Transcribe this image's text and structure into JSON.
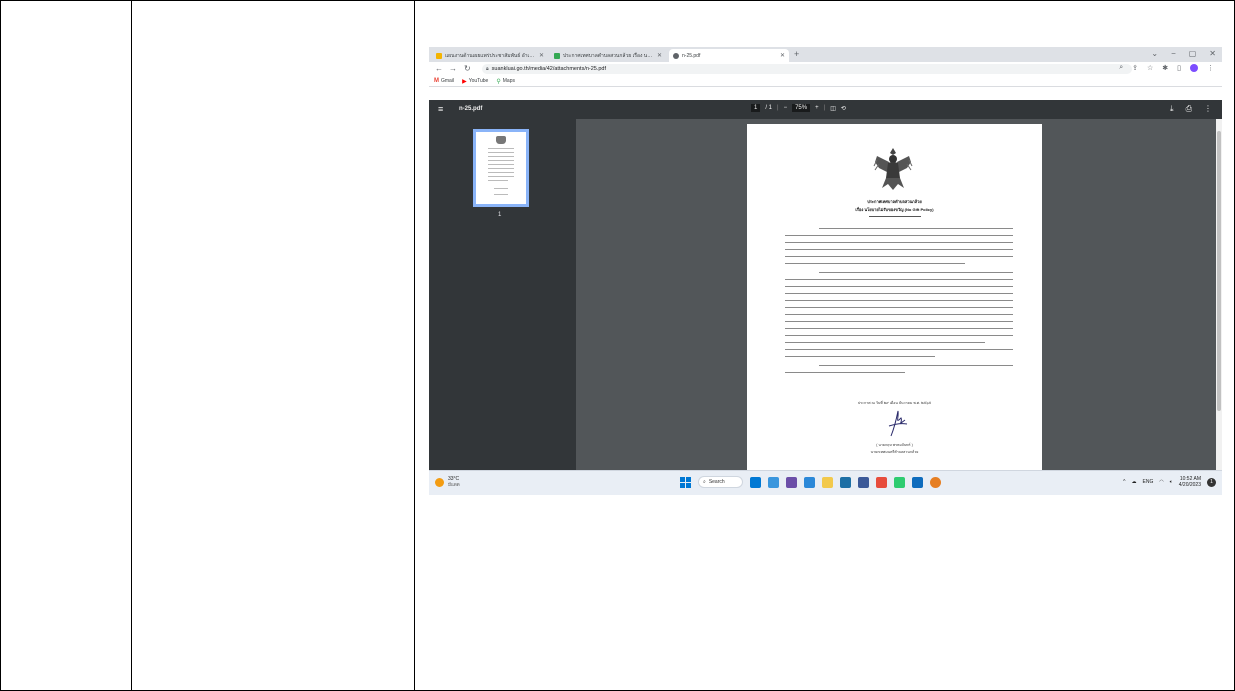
{
  "browser": {
    "tabs": [
      {
        "label": "แผนงานด้านเผยแพร่ประชาสัมพันธ์ อำเภอสวนหลวง",
        "color": "#f4b400"
      },
      {
        "label": "ประกาศเทศบาลตำบลสวนกล้วย เรื่อง นโยบาย",
        "color": "#34a853"
      },
      {
        "label": "n-25.pdf",
        "color": "#5f6368"
      }
    ],
    "new_tab": "+",
    "window_controls": [
      "⌄",
      "−",
      "▢",
      "✕"
    ],
    "url": "suankluai.go.th/media/42/attachments/n-25.pdf",
    "bookmarks": [
      {
        "icon": "M",
        "label": "Gmail",
        "color": "#ea4335"
      },
      {
        "icon": "▶",
        "label": "YouTube",
        "color": "#ff0000"
      },
      {
        "icon": "⚲",
        "label": "Maps",
        "color": "#34a853"
      }
    ]
  },
  "pdf": {
    "file_name": "n-25.pdf",
    "page_current": "1",
    "page_total": "/ 1",
    "zoom": "75%",
    "zoom_out": "−",
    "zoom_in": "+",
    "thumbnail_label": "1",
    "document": {
      "title_line1": "ประกาศเทศบาลตำบลสวนกล้วย",
      "title_line2": "เรื่อง นโยบายไม่รับของขวัญ (No Gift Policy)",
      "date_line": "ประกาศ ณ วันที่ ๒๙ เดือน ธันวาคม พ.ศ. ๒๕๖๕",
      "signer_name": "( นายกฤษ พรหมจันทร์ )",
      "signer_position": "นายกเทศมนตรีตำบลสวนกล้วย"
    }
  },
  "taskbar": {
    "temperature": "33°C",
    "condition": "มีแดด",
    "search_label": "Search",
    "apps": [
      "#0078d4",
      "#3a96dd",
      "#6b4ea8",
      "#2b88d8",
      "#f2c94c",
      "#1d6fa5",
      "#3b5998",
      "#e74c3c",
      "#2ecc71",
      "#0f6cbd",
      "#e67e22"
    ],
    "language": "ENG",
    "time": "10:52 AM",
    "date": "4/20/2023",
    "notification_count": "1"
  }
}
